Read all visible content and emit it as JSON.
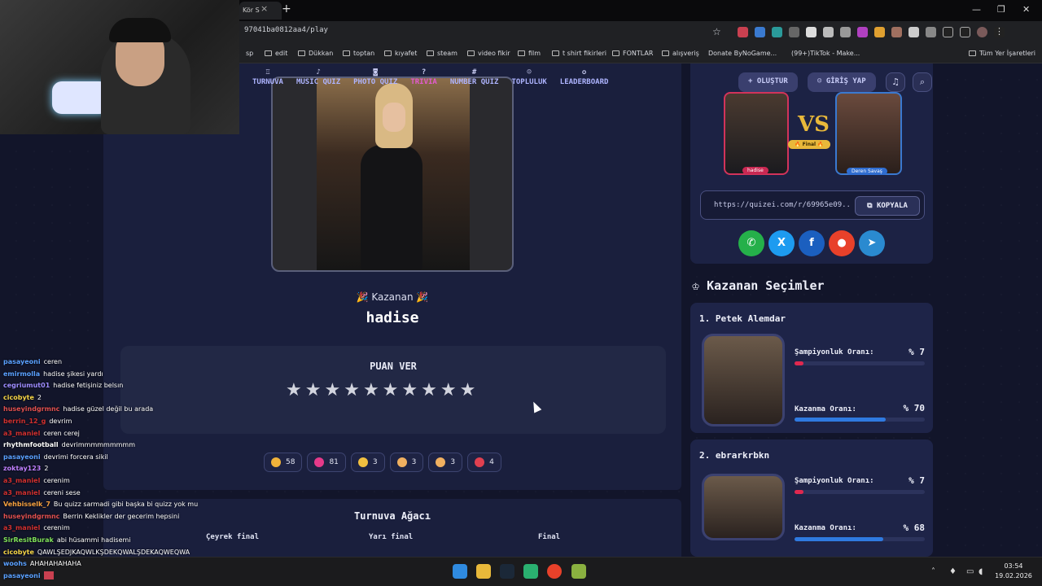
{
  "browser": {
    "tab_title": "Kör S",
    "url": "97041ba0812aa4/play",
    "bookmarks": [
      "sp",
      "edit",
      "Dükkan",
      "toptan",
      "kıyafet",
      "steam",
      "video fikir",
      "film",
      "t shirt fikirleri",
      "FONTLAR",
      "alışveriş",
      "Donate ByNoGame...",
      "(99+)TikTok - Make...",
      "Tüm Yer İşaretleri"
    ]
  },
  "nav": {
    "items": [
      {
        "label": "TURNUVA",
        "icon": "trophy-icon"
      },
      {
        "label": "MUSIC QUIZ",
        "icon": "music-icon"
      },
      {
        "label": "PHOTO QUIZ",
        "icon": "camera-icon"
      },
      {
        "label": "TRIVIA",
        "icon": "question-icon"
      },
      {
        "label": "NUMBER QUIZ",
        "icon": "hash-icon"
      },
      {
        "label": "TOPLULUK",
        "icon": "users-icon"
      },
      {
        "label": "LEADERBOARD",
        "icon": "medal-icon"
      }
    ],
    "create_label": "OLUŞTUR",
    "login_label": "GİRİŞ YAP"
  },
  "winner": {
    "label": "Kazanan",
    "name": "hadise"
  },
  "rating": {
    "title": "PUAN VER",
    "stars": 10
  },
  "reactions": [
    {
      "emoji": "thumbs-up-icon",
      "count": "58",
      "color": "#f0b23a"
    },
    {
      "emoji": "heart-icon",
      "count": "81",
      "color": "#e63a8a"
    },
    {
      "emoji": "laugh-icon",
      "count": "3",
      "color": "#f2c040"
    },
    {
      "emoji": "surprised-icon",
      "count": "3",
      "color": "#f0b060"
    },
    {
      "emoji": "sad-icon",
      "count": "3",
      "color": "#f0b060"
    },
    {
      "emoji": "angry-icon",
      "count": "4",
      "color": "#e04050"
    }
  ],
  "tree": {
    "title": "Turnuva Ağacı",
    "rounds": [
      "Çeyrek final",
      "Yarı final",
      "Final"
    ]
  },
  "share": {
    "finalist_a": "hadise",
    "finalist_b": "Deren Savaş",
    "vs": "VS",
    "final_badge": "Final",
    "url": "https://quizei.com/r/69965e09...",
    "copy_label": "KOPYALA",
    "socials": [
      {
        "name": "whatsapp-icon",
        "glyph": "✆",
        "color": "#25b04a"
      },
      {
        "name": "x-icon",
        "glyph": "X",
        "color": "#1d9bf0"
      },
      {
        "name": "facebook-icon",
        "glyph": "f",
        "color": "#1b5fbf"
      },
      {
        "name": "reddit-icon",
        "glyph": "●",
        "color": "#e8412a"
      },
      {
        "name": "telegram-icon",
        "glyph": "➤",
        "color": "#2a8ad0"
      }
    ]
  },
  "selections": {
    "title": "Kazanan Seçimler",
    "items": [
      {
        "rank_name": "1. Petek Alemdar",
        "champ_label": "Şampiyonluk Oranı:",
        "champ_val": "% 7",
        "champ_pct": 7,
        "win_label": "Kazanma Oranı:",
        "win_val": "% 70",
        "win_pct": 70
      },
      {
        "rank_name": "2. ebrarkrbkn",
        "champ_label": "Şampiyonluk Oranı:",
        "champ_val": "% 7",
        "champ_pct": 7,
        "win_label": "Kazanma Oranı:",
        "win_val": "% 68",
        "win_pct": 68
      }
    ]
  },
  "chat": [
    {
      "user": "pasayeoni",
      "color": "#5aa0ff",
      "msg": "ceren"
    },
    {
      "user": "emirmolla",
      "color": "#5aa0ff",
      "msg": "hadise şikesi yardı"
    },
    {
      "user": "cegriumut01",
      "color": "#9d8cff",
      "msg": "hadise fetişiniz belsın"
    },
    {
      "user": "cicobyte",
      "color": "#f5d547",
      "msg": "2"
    },
    {
      "user": "huseyindgrmnc",
      "color": "#e05050",
      "msg": "hadise güzel değil bu arada"
    },
    {
      "user": "berrin_12_g",
      "color": "#d03030",
      "msg": "devrim"
    },
    {
      "user": "a3_maniel",
      "color": "#d03030",
      "msg": "ceren cerej"
    },
    {
      "user": "rhythmfootball",
      "color": "#ffffff",
      "msg": "devrimmmmmmmmm"
    },
    {
      "user": "pasayeoni",
      "color": "#5aa0ff",
      "msg": "devrimi forcera sikil"
    },
    {
      "user": "zoktay123",
      "color": "#c080ff",
      "msg": "2"
    },
    {
      "user": "a3_maniel",
      "color": "#d03030",
      "msg": "cerenim"
    },
    {
      "user": "a3_maniel",
      "color": "#d03030",
      "msg": "cereni sese"
    },
    {
      "user": "Vehbisselk_7",
      "color": "#f5a040",
      "msg": "Bu quizz sarmadi gibi başka bi quizz yok mu"
    },
    {
      "user": "huseyindgrmnc",
      "color": "#e05050",
      "msg": "Berrin Keklikler der gecerim hepsini"
    },
    {
      "user": "a3_maniel",
      "color": "#d03030",
      "msg": "cerenim"
    },
    {
      "user": "SirResitBurak",
      "color": "#7fe05a",
      "msg": "abi hüsammi hadisemi"
    },
    {
      "user": "cicobyte",
      "color": "#f5d547",
      "msg": "QAWLŞEDJKAQWLKŞDEKQWALŞDEKAQWEQWA"
    },
    {
      "user": "woohs",
      "color": "#5aa0ff",
      "msg": "AHAHAHAHAHA"
    },
    {
      "user": "pasayeoni",
      "color": "#5aa0ff",
      "msg": ""
    }
  ],
  "taskbar": {
    "time": "03:54",
    "date": "19.02.2026"
  }
}
